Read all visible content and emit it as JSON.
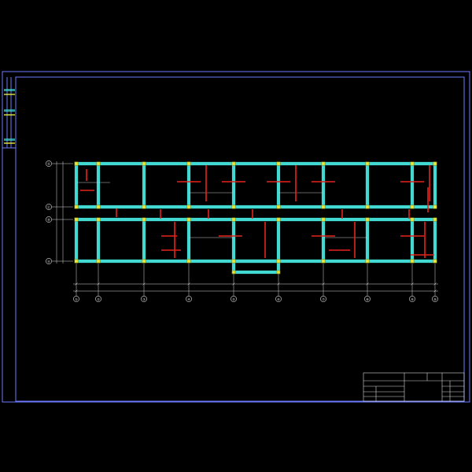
{
  "drawing": {
    "axes_horizontal": [
      "①",
      "②",
      "③",
      "④",
      "⑤",
      "⑥",
      "⑦",
      "⑧",
      "⑨",
      "⑩"
    ],
    "axes_vertical": [
      "Ⓐ",
      "Ⓑ",
      "Ⓒ",
      "Ⓓ"
    ],
    "colors": {
      "background": "#000000",
      "frame": "#6d7bff",
      "beam": "#41d9d2",
      "column": "#e6e840",
      "rebar": "#e8221c"
    }
  },
  "title_block": {
    "company": "",
    "drawing_title": "",
    "sheet_no": ""
  }
}
